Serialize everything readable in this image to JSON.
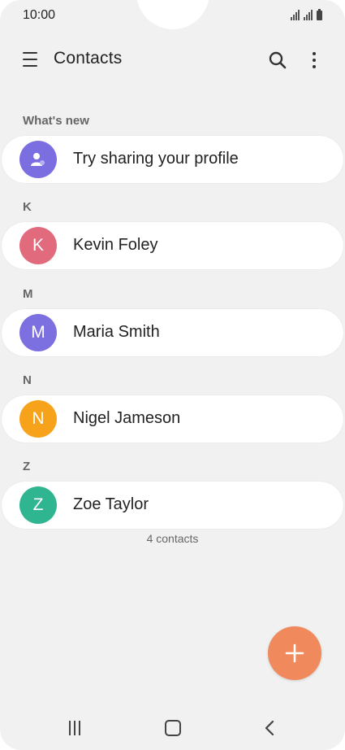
{
  "status_bar": {
    "time": "10:00"
  },
  "app_bar": {
    "title": "Contacts",
    "icons": [
      "menu-icon",
      "search-icon",
      "more-vert-icon"
    ]
  },
  "sections": [
    {
      "label": "What's new",
      "items": [
        {
          "initial": "",
          "name": "Try sharing your profile",
          "icon": "profile-share-icon",
          "color": "#7b6ee0"
        }
      ]
    },
    {
      "label": "K",
      "items": [
        {
          "initial": "K",
          "name": "Kevin Foley",
          "color": "#e26a7d"
        }
      ]
    },
    {
      "label": "M",
      "items": [
        {
          "initial": "M",
          "name": "Maria Smith",
          "color": "#7c6fe0"
        }
      ]
    },
    {
      "label": "N",
      "items": [
        {
          "initial": "N",
          "name": "Nigel Jameson",
          "color": "#f7a21b"
        }
      ]
    },
    {
      "label": "Z",
      "items": [
        {
          "initial": "Z",
          "name": "Zoe Taylor",
          "color": "#2fb590"
        }
      ]
    }
  ],
  "footer_count": "4 contacts",
  "fab": {
    "icon": "add-icon",
    "color": "#f08a5d"
  },
  "nav_bar": {
    "icons": [
      "recents-icon",
      "home-icon",
      "back-icon"
    ]
  }
}
